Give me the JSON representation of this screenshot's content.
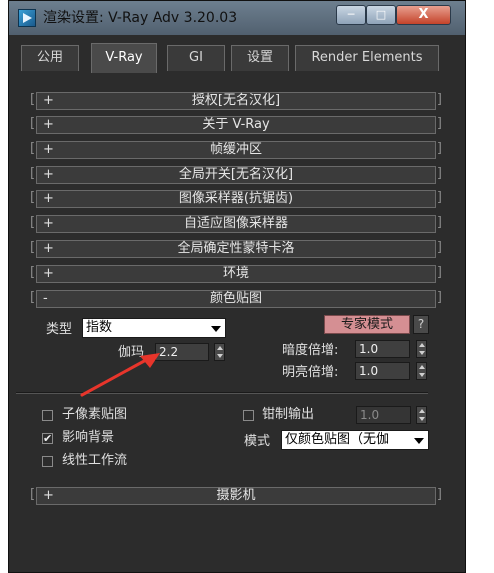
{
  "window": {
    "title": "渲染设置: V-Ray Adv 3.20.03",
    "min_label": "",
    "max_label": "",
    "close_label": "X"
  },
  "tabs": [
    {
      "label": "公用"
    },
    {
      "label": "V-Ray"
    },
    {
      "label": "GI"
    },
    {
      "label": "设置"
    },
    {
      "label": "Render Elements"
    }
  ],
  "active_tab": "V-Ray",
  "rollouts": [
    {
      "sign": "+",
      "label": "授权[无名汉化]"
    },
    {
      "sign": "+",
      "label": "关于 V-Ray"
    },
    {
      "sign": "+",
      "label": "帧缓冲区"
    },
    {
      "sign": "+",
      "label": "全局开关[无名汉化]"
    },
    {
      "sign": "+",
      "label": "图像采样器(抗锯齿)"
    },
    {
      "sign": "+",
      "label": "自适应图像采样器"
    },
    {
      "sign": "+",
      "label": "全局确定性蒙特卡洛"
    },
    {
      "sign": "+",
      "label": "环境"
    },
    {
      "sign": "-",
      "label": "颜色贴图"
    },
    {
      "sign": "+",
      "label": "摄影机"
    }
  ],
  "color_mapping": {
    "type_label": "类型",
    "type_value": "指数",
    "expert_mode": "专家模式",
    "help": "?",
    "gamma_label": "伽玛",
    "gamma_value": "2.2",
    "dark_mult_label": "暗度倍增:",
    "dark_mult_value": "1.0",
    "bright_mult_label": "明亮倍增:",
    "bright_mult_value": "1.0",
    "subpixel_label": "子像素贴图",
    "subpixel_checked": false,
    "affect_bg_label": "影响背景",
    "affect_bg_checked": true,
    "linear_workflow_label": "线性工作流",
    "linear_workflow_checked": false,
    "clamp_label": "钳制输出",
    "clamp_checked": false,
    "clamp_value": "1.0",
    "mode_label": "模式",
    "mode_value": "仅颜色贴图（无伽"
  },
  "colors": {
    "panel_bg": "#2c2c2c",
    "expert_button": "#d58f93",
    "annotation_arrow": "#e8352b"
  }
}
